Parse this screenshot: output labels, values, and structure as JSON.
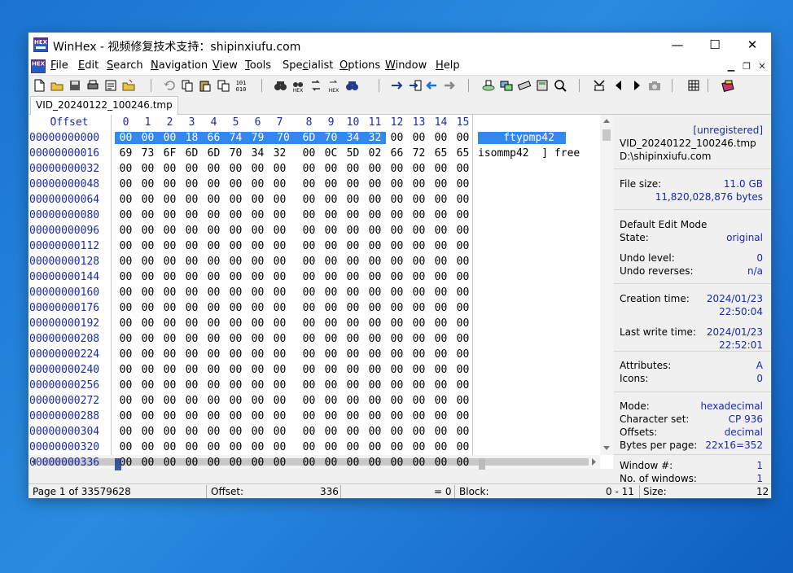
{
  "window": {
    "title": "WinHex - 视频修复技术支持：shipinxiufu.com",
    "minimize_glyph": "—",
    "maximize_glyph": "☐",
    "close_glyph": "✕"
  },
  "menu": {
    "items": [
      {
        "label": "File",
        "accel": "F",
        "rest": "ile"
      },
      {
        "label": "Edit",
        "accel": "E",
        "rest": "dit"
      },
      {
        "label": "Search",
        "accel": "S",
        "rest": "earch"
      },
      {
        "label": "Navigation",
        "accel": "N",
        "rest": "avigation"
      },
      {
        "label": "View",
        "accel": "V",
        "rest": "iew"
      },
      {
        "label": "Tools",
        "accel": "T",
        "rest": "ools"
      },
      {
        "label": "Specialist",
        "pre": "Spe",
        "accel": "c",
        "rest": "ialist"
      },
      {
        "label": "Options",
        "accel": "O",
        "rest": "ptions"
      },
      {
        "label": "Window",
        "accel": "W",
        "rest": "indow"
      },
      {
        "label": "Help",
        "accel": "H",
        "rest": "elp"
      }
    ]
  },
  "toolbar_icons": [
    "new-file-icon",
    "open-folder-icon",
    "save-icon",
    "print-icon",
    "properties-icon",
    "open-special-icon",
    "undo-icon",
    "copy-icon",
    "paste-icon",
    "paste-special-icon",
    "hex-101-icon",
    "find-text-icon",
    "find-hex-icon",
    "replace-text-icon",
    "replace-hex-icon",
    "find-again-icon",
    "goto-offset-icon",
    "goto-sector-icon",
    "back-icon",
    "forward-icon",
    "open-disk-icon",
    "clone-disk-icon",
    "ram-icon",
    "calculator-icon",
    "magnifier-icon",
    "binoculars-icon",
    "prev-icon",
    "next-icon",
    "camera-icon",
    "table-icon",
    "books-icon"
  ],
  "tab": {
    "label": "VID_20240122_100246.tmp"
  },
  "editor": {
    "offset_header": "Offset",
    "columns": [
      "0",
      "1",
      "2",
      "3",
      "4",
      "5",
      "6",
      "7",
      "8",
      "9",
      "10",
      "11",
      "12",
      "13",
      "14",
      "15"
    ],
    "rows": [
      {
        "offset": "00000000000",
        "bytes": [
          "00",
          "00",
          "00",
          "18",
          "66",
          "74",
          "79",
          "70",
          "6D",
          "70",
          "34",
          "32",
          "00",
          "00",
          "00",
          "00"
        ],
        "text": "    ftypmp42"
      },
      {
        "offset": "00000000016",
        "bytes": [
          "69",
          "73",
          "6F",
          "6D",
          "6D",
          "70",
          "34",
          "32",
          "00",
          "0C",
          "5D",
          "02",
          "66",
          "72",
          "65",
          "65"
        ],
        "text": "isommp42  ] free"
      },
      {
        "offset": "00000000032",
        "bytes": [
          "00",
          "00",
          "00",
          "00",
          "00",
          "00",
          "00",
          "00",
          "00",
          "00",
          "00",
          "00",
          "00",
          "00",
          "00",
          "00"
        ],
        "text": ""
      },
      {
        "offset": "00000000048",
        "bytes": [
          "00",
          "00",
          "00",
          "00",
          "00",
          "00",
          "00",
          "00",
          "00",
          "00",
          "00",
          "00",
          "00",
          "00",
          "00",
          "00"
        ],
        "text": ""
      },
      {
        "offset": "00000000064",
        "bytes": [
          "00",
          "00",
          "00",
          "00",
          "00",
          "00",
          "00",
          "00",
          "00",
          "00",
          "00",
          "00",
          "00",
          "00",
          "00",
          "00"
        ],
        "text": ""
      },
      {
        "offset": "00000000080",
        "bytes": [
          "00",
          "00",
          "00",
          "00",
          "00",
          "00",
          "00",
          "00",
          "00",
          "00",
          "00",
          "00",
          "00",
          "00",
          "00",
          "00"
        ],
        "text": ""
      },
      {
        "offset": "00000000096",
        "bytes": [
          "00",
          "00",
          "00",
          "00",
          "00",
          "00",
          "00",
          "00",
          "00",
          "00",
          "00",
          "00",
          "00",
          "00",
          "00",
          "00"
        ],
        "text": ""
      },
      {
        "offset": "00000000112",
        "bytes": [
          "00",
          "00",
          "00",
          "00",
          "00",
          "00",
          "00",
          "00",
          "00",
          "00",
          "00",
          "00",
          "00",
          "00",
          "00",
          "00"
        ],
        "text": ""
      },
      {
        "offset": "00000000128",
        "bytes": [
          "00",
          "00",
          "00",
          "00",
          "00",
          "00",
          "00",
          "00",
          "00",
          "00",
          "00",
          "00",
          "00",
          "00",
          "00",
          "00"
        ],
        "text": ""
      },
      {
        "offset": "00000000144",
        "bytes": [
          "00",
          "00",
          "00",
          "00",
          "00",
          "00",
          "00",
          "00",
          "00",
          "00",
          "00",
          "00",
          "00",
          "00",
          "00",
          "00"
        ],
        "text": ""
      },
      {
        "offset": "00000000160",
        "bytes": [
          "00",
          "00",
          "00",
          "00",
          "00",
          "00",
          "00",
          "00",
          "00",
          "00",
          "00",
          "00",
          "00",
          "00",
          "00",
          "00"
        ],
        "text": ""
      },
      {
        "offset": "00000000176",
        "bytes": [
          "00",
          "00",
          "00",
          "00",
          "00",
          "00",
          "00",
          "00",
          "00",
          "00",
          "00",
          "00",
          "00",
          "00",
          "00",
          "00"
        ],
        "text": ""
      },
      {
        "offset": "00000000192",
        "bytes": [
          "00",
          "00",
          "00",
          "00",
          "00",
          "00",
          "00",
          "00",
          "00",
          "00",
          "00",
          "00",
          "00",
          "00",
          "00",
          "00"
        ],
        "text": ""
      },
      {
        "offset": "00000000208",
        "bytes": [
          "00",
          "00",
          "00",
          "00",
          "00",
          "00",
          "00",
          "00",
          "00",
          "00",
          "00",
          "00",
          "00",
          "00",
          "00",
          "00"
        ],
        "text": ""
      },
      {
        "offset": "00000000224",
        "bytes": [
          "00",
          "00",
          "00",
          "00",
          "00",
          "00",
          "00",
          "00",
          "00",
          "00",
          "00",
          "00",
          "00",
          "00",
          "00",
          "00"
        ],
        "text": ""
      },
      {
        "offset": "00000000240",
        "bytes": [
          "00",
          "00",
          "00",
          "00",
          "00",
          "00",
          "00",
          "00",
          "00",
          "00",
          "00",
          "00",
          "00",
          "00",
          "00",
          "00"
        ],
        "text": ""
      },
      {
        "offset": "00000000256",
        "bytes": [
          "00",
          "00",
          "00",
          "00",
          "00",
          "00",
          "00",
          "00",
          "00",
          "00",
          "00",
          "00",
          "00",
          "00",
          "00",
          "00"
        ],
        "text": ""
      },
      {
        "offset": "00000000272",
        "bytes": [
          "00",
          "00",
          "00",
          "00",
          "00",
          "00",
          "00",
          "00",
          "00",
          "00",
          "00",
          "00",
          "00",
          "00",
          "00",
          "00"
        ],
        "text": ""
      },
      {
        "offset": "00000000288",
        "bytes": [
          "00",
          "00",
          "00",
          "00",
          "00",
          "00",
          "00",
          "00",
          "00",
          "00",
          "00",
          "00",
          "00",
          "00",
          "00",
          "00"
        ],
        "text": ""
      },
      {
        "offset": "00000000304",
        "bytes": [
          "00",
          "00",
          "00",
          "00",
          "00",
          "00",
          "00",
          "00",
          "00",
          "00",
          "00",
          "00",
          "00",
          "00",
          "00",
          "00"
        ],
        "text": ""
      },
      {
        "offset": "00000000320",
        "bytes": [
          "00",
          "00",
          "00",
          "00",
          "00",
          "00",
          "00",
          "00",
          "00",
          "00",
          "00",
          "00",
          "00",
          "00",
          "00",
          "00"
        ],
        "text": ""
      },
      {
        "offset": "00000000336",
        "bytes": [
          "00",
          "00",
          "00",
          "00",
          "00",
          "00",
          "00",
          "00",
          "00",
          "00",
          "00",
          "00",
          "00",
          "00",
          "00",
          "00"
        ],
        "text": ""
      }
    ],
    "selected_bytes": 12,
    "selection_color": "#3388ee",
    "offset_color": "#1a2aa8"
  },
  "info": {
    "registration": "[unregistered]",
    "filename": "VID_20240122_100246.tmp",
    "path": "D:\\shipinxiufu.com",
    "file_size_label": "File size:",
    "file_size_gb": "11.0 GB",
    "file_size_bytes": "11,820,028,876 bytes",
    "edit_mode": "Default Edit Mode",
    "state_label": "State:",
    "state_value": "original",
    "undo_level_label": "Undo level:",
    "undo_level_value": "0",
    "undo_rev_label": "Undo reverses:",
    "undo_rev_value": "n/a",
    "creation_label": "Creation time:",
    "creation_date": "2024/01/23",
    "creation_time": "22:50:04",
    "lastwrite_label": "Last write time:",
    "lastwrite_date": "2024/01/23",
    "lastwrite_time": "22:52:01",
    "attributes_label": "Attributes:",
    "attributes_value": "A",
    "icons_label": "Icons:",
    "icons_value": "0",
    "mode_label": "Mode:",
    "mode_value": "hexadecimal",
    "charset_label": "Character set:",
    "charset_value": "CP 936",
    "offsets_label": "Offsets:",
    "offsets_value": "decimal",
    "bpp_label": "Bytes per page:",
    "bpp_value": "22x16=352",
    "window_no_label": "Window #:",
    "window_no_value": "1",
    "num_windows_label": "No. of windows:",
    "num_windows_value": "1"
  },
  "status": {
    "page": "Page 1 of 33579628",
    "offset_label": "Offset:",
    "offset_value": "336",
    "equals": "= 0",
    "block_label": "Block:",
    "block_value": "0 - 11",
    "size_label": "Size:",
    "size_value": "12"
  }
}
